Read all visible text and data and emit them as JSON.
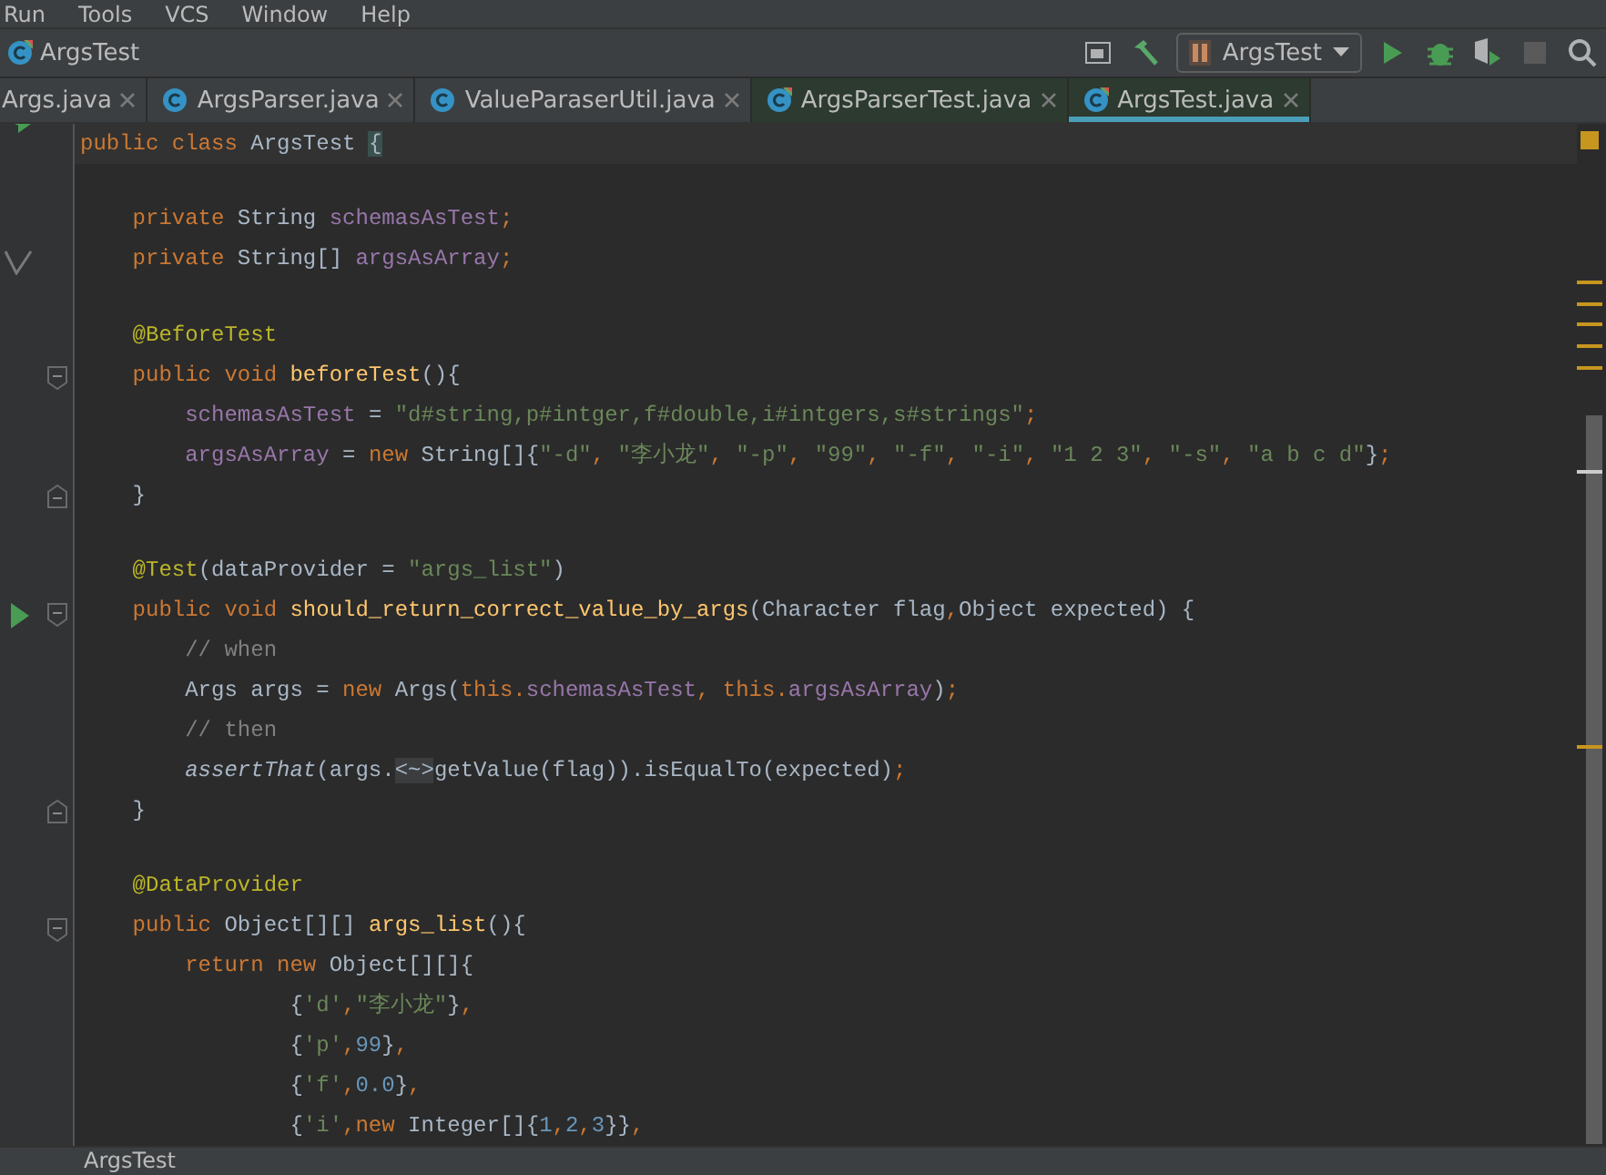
{
  "menu": [
    "Run",
    "Tools",
    "VCS",
    "Window",
    "Help"
  ],
  "navbar": {
    "title": "ArgsTest",
    "run_config": "ArgsTest"
  },
  "toolbar": [
    {
      "kind": "layout",
      "disabled": false
    },
    {
      "kind": "build",
      "disabled": false
    },
    {
      "kind": "config"
    },
    {
      "kind": "run",
      "disabled": false
    },
    {
      "kind": "debug",
      "disabled": false
    },
    {
      "kind": "coverage",
      "disabled": false
    },
    {
      "kind": "stop",
      "disabled": true
    },
    {
      "kind": "search",
      "disabled": false
    }
  ],
  "tabs": [
    {
      "label": "Args.java",
      "kind": "source",
      "selected": false,
      "icon": false
    },
    {
      "label": "ArgsParser.java",
      "kind": "source",
      "selected": false,
      "icon": true
    },
    {
      "label": "ValueParaserUtil.java",
      "kind": "source",
      "selected": false,
      "icon": true
    },
    {
      "label": "ArgsParserTest.java",
      "kind": "test",
      "selected": false,
      "icon": true
    },
    {
      "label": "ArgsTest.java",
      "kind": "test",
      "selected": true,
      "icon": true
    }
  ],
  "editor": {
    "lines": [
      {
        "kind": "code",
        "gutter": [
          {
            "kind": "run-class"
          }
        ],
        "current": true,
        "tokens": [
          {
            "kind": "kw",
            "text": "public class "
          },
          {
            "kind": "plain",
            "text": "ArgsTest "
          },
          {
            "kind": "brace",
            "text": "{"
          }
        ]
      },
      {
        "kind": "blank"
      },
      {
        "kind": "code",
        "tokens": [
          {
            "kind": "kw",
            "text": "    private "
          },
          {
            "kind": "plain",
            "text": "String "
          },
          {
            "kind": "field",
            "text": "schemasAsTest"
          },
          {
            "kind": "kw",
            "text": ";"
          }
        ]
      },
      {
        "kind": "code",
        "gutter": [
          {
            "kind": "check"
          }
        ],
        "tokens": [
          {
            "kind": "kw",
            "text": "    private "
          },
          {
            "kind": "plain",
            "text": "String[] "
          },
          {
            "kind": "field",
            "text": "argsAsArray"
          },
          {
            "kind": "kw",
            "text": ";"
          }
        ]
      },
      {
        "kind": "blank"
      },
      {
        "kind": "code",
        "tokens": [
          {
            "kind": "anno",
            "text": "    @BeforeTest"
          }
        ]
      },
      {
        "kind": "code",
        "gutter": [
          {
            "kind": "fold-start"
          }
        ],
        "tokens": [
          {
            "kind": "kw",
            "text": "    public void "
          },
          {
            "kind": "method",
            "text": "beforeTest"
          },
          {
            "kind": "plain",
            "text": "(){"
          }
        ]
      },
      {
        "kind": "code",
        "tokens": [
          {
            "kind": "field",
            "text": "        schemasAsTest "
          },
          {
            "kind": "plain",
            "text": "= "
          },
          {
            "kind": "str",
            "text": "\"d#string,p#intger,f#double,i#intgers,s#strings\""
          },
          {
            "kind": "kw",
            "text": ";"
          }
        ]
      },
      {
        "kind": "code",
        "tokens": [
          {
            "kind": "field",
            "text": "        argsAsArray "
          },
          {
            "kind": "plain",
            "text": "= "
          },
          {
            "kind": "kw",
            "text": "new "
          },
          {
            "kind": "plain",
            "text": "String[]{"
          },
          {
            "kind": "str",
            "text": "\"-d\""
          },
          {
            "kind": "kw",
            "text": ", "
          },
          {
            "kind": "str",
            "text": "\"李小龙\""
          },
          {
            "kind": "kw",
            "text": ", "
          },
          {
            "kind": "str",
            "text": "\"-p\""
          },
          {
            "kind": "kw",
            "text": ", "
          },
          {
            "kind": "str",
            "text": "\"99\""
          },
          {
            "kind": "kw",
            "text": ", "
          },
          {
            "kind": "str",
            "text": "\"-f\""
          },
          {
            "kind": "kw",
            "text": ", "
          },
          {
            "kind": "str",
            "text": "\"-i\""
          },
          {
            "kind": "kw",
            "text": ", "
          },
          {
            "kind": "str",
            "text": "\"1 2 3\""
          },
          {
            "kind": "kw",
            "text": ", "
          },
          {
            "kind": "str",
            "text": "\"-s\""
          },
          {
            "kind": "kw",
            "text": ", "
          },
          {
            "kind": "str",
            "text": "\"a b c d\""
          },
          {
            "kind": "plain",
            "text": "}"
          },
          {
            "kind": "kw",
            "text": ";"
          }
        ]
      },
      {
        "kind": "code",
        "gutter": [
          {
            "kind": "fold-end"
          }
        ],
        "tokens": [
          {
            "kind": "plain",
            "text": "    }"
          }
        ]
      },
      {
        "kind": "blank"
      },
      {
        "kind": "code",
        "tokens": [
          {
            "kind": "anno",
            "text": "    @Test"
          },
          {
            "kind": "plain",
            "text": "(dataProvider = "
          },
          {
            "kind": "str",
            "text": "\"args_list\""
          },
          {
            "kind": "plain",
            "text": ")"
          }
        ]
      },
      {
        "kind": "code",
        "gutter": [
          {
            "kind": "run"
          },
          {
            "kind": "fold-start"
          }
        ],
        "tokens": [
          {
            "kind": "kw",
            "text": "    public void "
          },
          {
            "kind": "method",
            "text": "should_return_correct_value_by_args"
          },
          {
            "kind": "plain",
            "text": "(Character flag"
          },
          {
            "kind": "kw",
            "text": ","
          },
          {
            "kind": "plain",
            "text": "Object expected) {"
          }
        ]
      },
      {
        "kind": "code",
        "tokens": [
          {
            "kind": "comment",
            "text": "        // when"
          }
        ]
      },
      {
        "kind": "code",
        "tokens": [
          {
            "kind": "plain",
            "text": "        Args args = "
          },
          {
            "kind": "kw",
            "text": "new "
          },
          {
            "kind": "plain",
            "text": "Args("
          },
          {
            "kind": "kw",
            "text": "this."
          },
          {
            "kind": "field",
            "text": "schemasAsTest"
          },
          {
            "kind": "kw",
            "text": ", this."
          },
          {
            "kind": "field",
            "text": "argsAsArray"
          },
          {
            "kind": "plain",
            "text": ")"
          },
          {
            "kind": "kw",
            "text": ";"
          }
        ]
      },
      {
        "kind": "code",
        "tokens": [
          {
            "kind": "comment",
            "text": "        // then"
          }
        ]
      },
      {
        "kind": "code",
        "tokens": [
          {
            "kind": "static",
            "text": "        assertThat"
          },
          {
            "kind": "plain",
            "text": "(args."
          },
          {
            "kind": "folded",
            "text": "<~>"
          },
          {
            "kind": "plain",
            "text": "getValue(flag)).isEqualTo(expected)"
          },
          {
            "kind": "kw",
            "text": ";"
          }
        ]
      },
      {
        "kind": "code",
        "gutter": [
          {
            "kind": "fold-end"
          }
        ],
        "tokens": [
          {
            "kind": "plain",
            "text": "    }"
          }
        ]
      },
      {
        "kind": "blank"
      },
      {
        "kind": "code",
        "tokens": [
          {
            "kind": "anno",
            "text": "    @DataProvider"
          }
        ]
      },
      {
        "kind": "code",
        "gutter": [
          {
            "kind": "fold-start"
          }
        ],
        "tokens": [
          {
            "kind": "kw",
            "text": "    public "
          },
          {
            "kind": "plain",
            "text": "Object[][] "
          },
          {
            "kind": "method",
            "text": "args_list"
          },
          {
            "kind": "plain",
            "text": "(){"
          }
        ]
      },
      {
        "kind": "code",
        "tokens": [
          {
            "kind": "kw",
            "text": "        return new "
          },
          {
            "kind": "plain",
            "text": "Object[][]{"
          }
        ]
      },
      {
        "kind": "code",
        "tokens": [
          {
            "kind": "plain",
            "text": "                {"
          },
          {
            "kind": "str",
            "text": "'d'"
          },
          {
            "kind": "kw",
            "text": ","
          },
          {
            "kind": "str",
            "text": "\"李小龙\""
          },
          {
            "kind": "plain",
            "text": "}"
          },
          {
            "kind": "kw",
            "text": ","
          }
        ]
      },
      {
        "kind": "code",
        "tokens": [
          {
            "kind": "plain",
            "text": "                {"
          },
          {
            "kind": "str",
            "text": "'p'"
          },
          {
            "kind": "kw",
            "text": ","
          },
          {
            "kind": "num",
            "text": "99"
          },
          {
            "kind": "plain",
            "text": "}"
          },
          {
            "kind": "kw",
            "text": ","
          }
        ]
      },
      {
        "kind": "code",
        "tokens": [
          {
            "kind": "plain",
            "text": "                {"
          },
          {
            "kind": "str",
            "text": "'f'"
          },
          {
            "kind": "kw",
            "text": ","
          },
          {
            "kind": "num",
            "text": "0.0"
          },
          {
            "kind": "plain",
            "text": "}"
          },
          {
            "kind": "kw",
            "text": ","
          }
        ]
      },
      {
        "kind": "code",
        "tokens": [
          {
            "kind": "plain",
            "text": "                {"
          },
          {
            "kind": "str",
            "text": "'i'"
          },
          {
            "kind": "kw",
            "text": ",new "
          },
          {
            "kind": "plain",
            "text": "Integer[]{"
          },
          {
            "kind": "num",
            "text": "1"
          },
          {
            "kind": "kw",
            "text": ","
          },
          {
            "kind": "num",
            "text": "2"
          },
          {
            "kind": "kw",
            "text": ","
          },
          {
            "kind": "num",
            "text": "3"
          },
          {
            "kind": "plain",
            "text": "}}"
          },
          {
            "kind": "kw",
            "text": ","
          }
        ]
      }
    ]
  },
  "status_bar": {
    "text": "ArgsTest"
  }
}
